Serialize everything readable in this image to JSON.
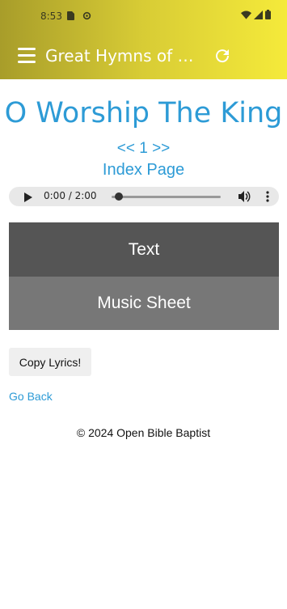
{
  "status_bar": {
    "time": "8:53"
  },
  "toolbar": {
    "title": "Great Hymns of th..."
  },
  "hymn": {
    "title": "O Worship The King",
    "prev_label": "<<",
    "number": "1",
    "next_label": ">>",
    "index_label": "Index Page"
  },
  "audio": {
    "time_display": "0:00 / 2:00",
    "progress": 0
  },
  "tabs": {
    "text_label": "Text",
    "music_label": "Music Sheet"
  },
  "actions": {
    "copy_label": "Copy Lyrics!",
    "go_back_label": "Go Back"
  },
  "footer": {
    "text": "© 2024 Open Bible Baptist"
  },
  "colors": {
    "accent": "#2d9bd6",
    "header_start": "#a89d2a",
    "header_end": "#f5ea3a",
    "tab_active": "#555555",
    "tab_inactive": "#777777"
  }
}
